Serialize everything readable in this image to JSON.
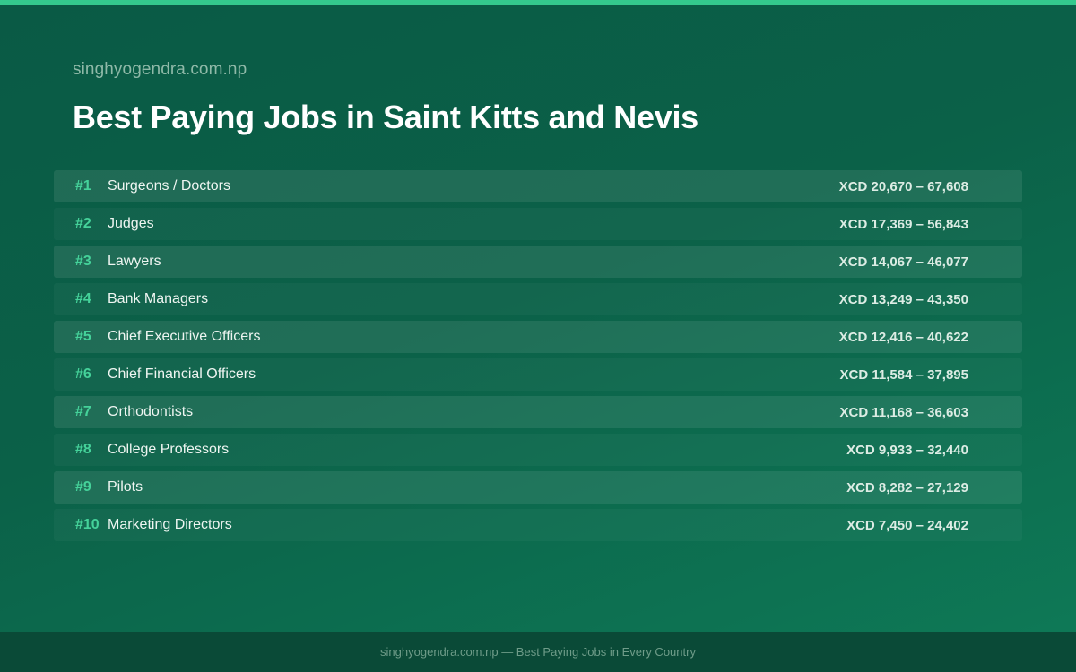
{
  "header": {
    "site": "singhyogendra.com.np",
    "title": "Best Paying Jobs in Saint Kitts and Nevis"
  },
  "jobs": [
    {
      "rank": "#1",
      "title": "Surgeons / Doctors",
      "salary": "XCD 20,670 – 67,608"
    },
    {
      "rank": "#2",
      "title": "Judges",
      "salary": "XCD 17,369 – 56,843"
    },
    {
      "rank": "#3",
      "title": "Lawyers",
      "salary": "XCD 14,067 – 46,077"
    },
    {
      "rank": "#4",
      "title": "Bank Managers",
      "salary": "XCD 13,249 – 43,350"
    },
    {
      "rank": "#5",
      "title": "Chief Executive Officers",
      "salary": "XCD 12,416 – 40,622"
    },
    {
      "rank": "#6",
      "title": "Chief Financial Officers",
      "salary": "XCD 11,584 – 37,895"
    },
    {
      "rank": "#7",
      "title": "Orthodontists",
      "salary": "XCD 11,168 – 36,603"
    },
    {
      "rank": "#8",
      "title": "College Professors",
      "salary": "XCD 9,933 – 32,440"
    },
    {
      "rank": "#9",
      "title": "Pilots",
      "salary": "XCD 8,282 – 27,129"
    },
    {
      "rank": "#10",
      "title": "Marketing Directors",
      "salary": "XCD 7,450 – 24,402"
    }
  ],
  "footer": {
    "text": "singhyogendra.com.np — Best Paying Jobs in Every Country"
  },
  "colors": {
    "accent": "#34c98d",
    "rank": "#45d29a",
    "background": "#0b6148"
  }
}
